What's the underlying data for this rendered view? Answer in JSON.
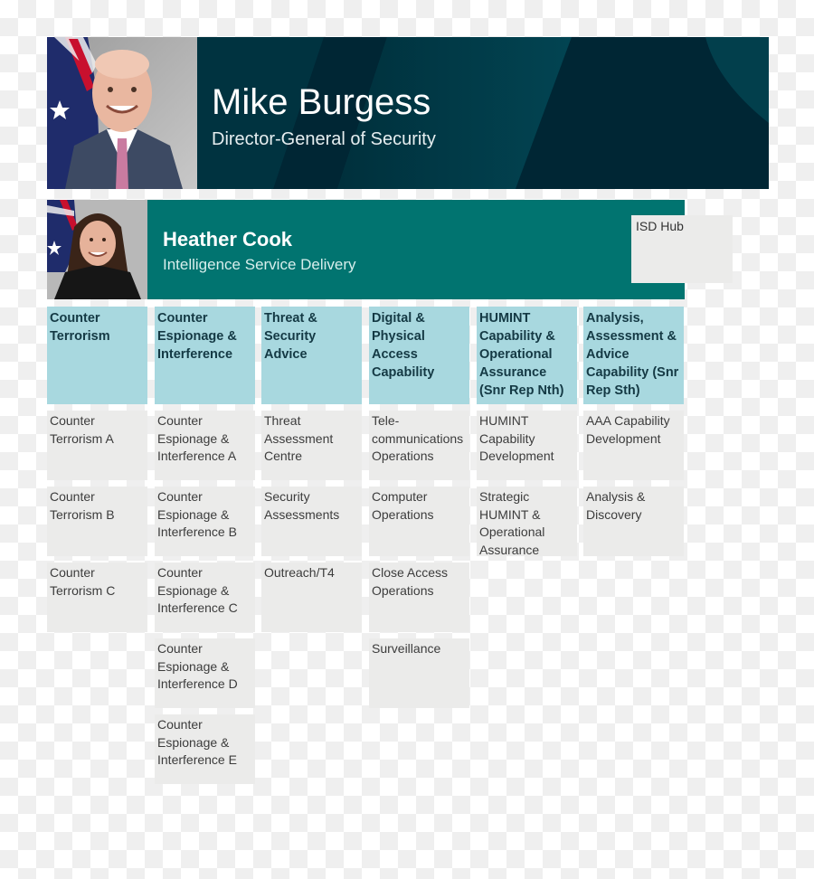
{
  "director_general": {
    "name": "Mike Burgess",
    "title": "Director-General of Security",
    "photo": "portrait-photo-with-australian-flag"
  },
  "division": {
    "name": "Heather Cook",
    "title": "Intelligence Service Delivery",
    "photo": "portrait-photo-with-australian-flag",
    "hub_label": "ISD Hub"
  },
  "colors": {
    "dg_banner": "#003c4a",
    "division_banner": "#017470",
    "branch_header": "#a8d8df",
    "unit_box": "#ebebea"
  },
  "branches": [
    {
      "label": "Counter Terrorism",
      "units": [
        "Counter Terrorism A",
        "Counter Terrorism B",
        "Counter Terrorism C"
      ]
    },
    {
      "label": "Counter Espionage & Interference",
      "units": [
        "Counter Espionage & Interference A",
        "Counter Espionage & Interference B",
        "Counter Espionage & Interference C",
        "Counter Espionage & Interference D",
        "Counter Espionage & Interference E"
      ]
    },
    {
      "label": "Threat & Security Advice",
      "units": [
        "Threat Assessment Centre",
        "Security Assessments",
        "Outreach/T4"
      ]
    },
    {
      "label": "Digital & Physical Access Capability",
      "units": [
        "Tele-communications Operations",
        "Computer Operations",
        "Close Access Operations",
        "Surveillance"
      ]
    },
    {
      "label": "HUMINT Capability & Operational Assurance (Snr Rep Nth)",
      "units": [
        "HUMINT Capability Development",
        "Strategic HUMINT & Operational Assurance"
      ]
    },
    {
      "label": "Analysis, Assessment & Advice Capability (Snr Rep Sth)",
      "units": [
        "AAA Capability Development",
        "Analysis & Discovery"
      ]
    }
  ]
}
